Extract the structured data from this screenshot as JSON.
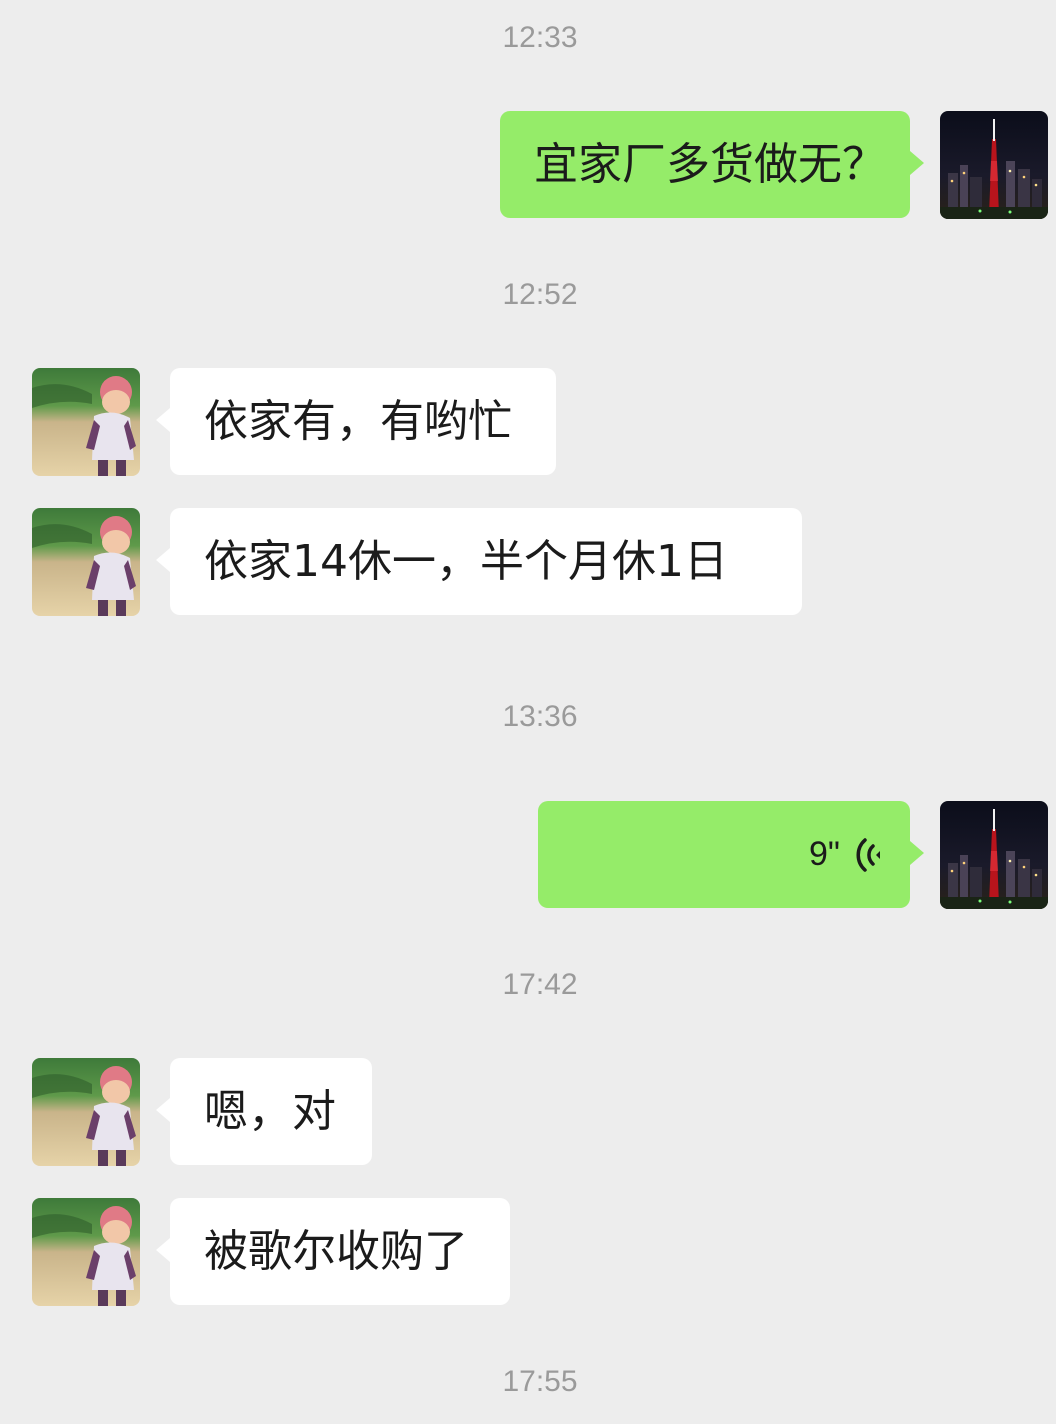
{
  "conversation": {
    "timestamps": [
      "12:33",
      "12:52",
      "13:36",
      "17:42",
      "17:55"
    ],
    "messages": [
      {
        "direction": "outgoing",
        "type": "text",
        "text": "宜家厂多货做无？"
      },
      {
        "direction": "incoming",
        "type": "text",
        "text": "依家有，有哟忙"
      },
      {
        "direction": "incoming",
        "type": "text",
        "text": "依家14休一，半个月休1日"
      },
      {
        "direction": "outgoing",
        "type": "voice",
        "duration": "9\""
      },
      {
        "direction": "incoming",
        "type": "text",
        "text": "嗯，对"
      },
      {
        "direction": "incoming",
        "type": "text",
        "text": "被歌尔收购了"
      }
    ]
  },
  "icons": {
    "voice": "voice-wave-icon",
    "self_avatar": "night-city-tower-avatar",
    "contact_avatar": "child-photo-avatar"
  },
  "colors": {
    "background": "#ededed",
    "outgoing_bubble": "#95ec69",
    "incoming_bubble": "#ffffff",
    "timestamp_text": "#9a9a9a"
  }
}
